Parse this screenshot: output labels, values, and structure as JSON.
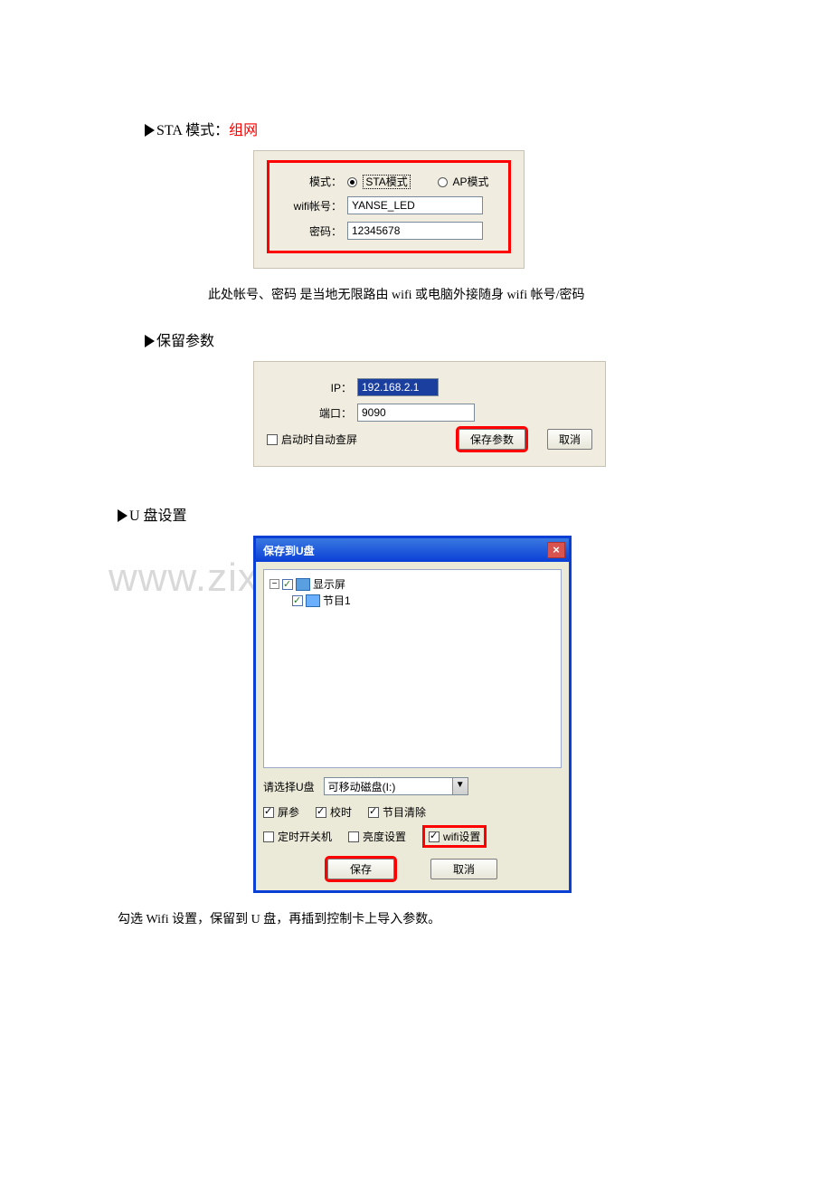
{
  "section1": {
    "prefix": "STA 模式：",
    "suffix": "组网"
  },
  "panel1": {
    "mode_label": "模式：",
    "sta_label": "STA模式",
    "ap_label": "AP模式",
    "wifi_label": "wifi帐号：",
    "wifi_value": "YANSE_LED",
    "pwd_label": "密码：",
    "pwd_value": "12345678"
  },
  "note1": "此处帐号、密码 是当地无限路由 wifi 或电脑外接随身 wifi 帐号/密码",
  "section2": "保留参数",
  "panel2": {
    "ip_label": "IP：",
    "ip_value": "192.168.2.1",
    "port_label": "端口：",
    "port_value": "9090",
    "auto_label": "启动时自动查屏",
    "save_btn": "保存参数",
    "cancel_btn": "取消"
  },
  "section3": "U 盘设置",
  "watermark": "www.zixin.com.cn",
  "dialog": {
    "title": "保存到U盘",
    "tree_root": "显示屏",
    "tree_child": "节目1",
    "select_label": "请选择U盘",
    "select_value": "可移动磁盘(I:)",
    "opt_screen": "屏参",
    "opt_time": "校时",
    "opt_clear": "节目清除",
    "opt_timer": "定时开关机",
    "opt_bright": "亮度设置",
    "opt_wifi": "wifi设置",
    "btn_save": "保存",
    "btn_cancel": "取消"
  },
  "note2": "勾选 Wifi 设置，保留到 U 盘，再插到控制卡上导入参数。"
}
